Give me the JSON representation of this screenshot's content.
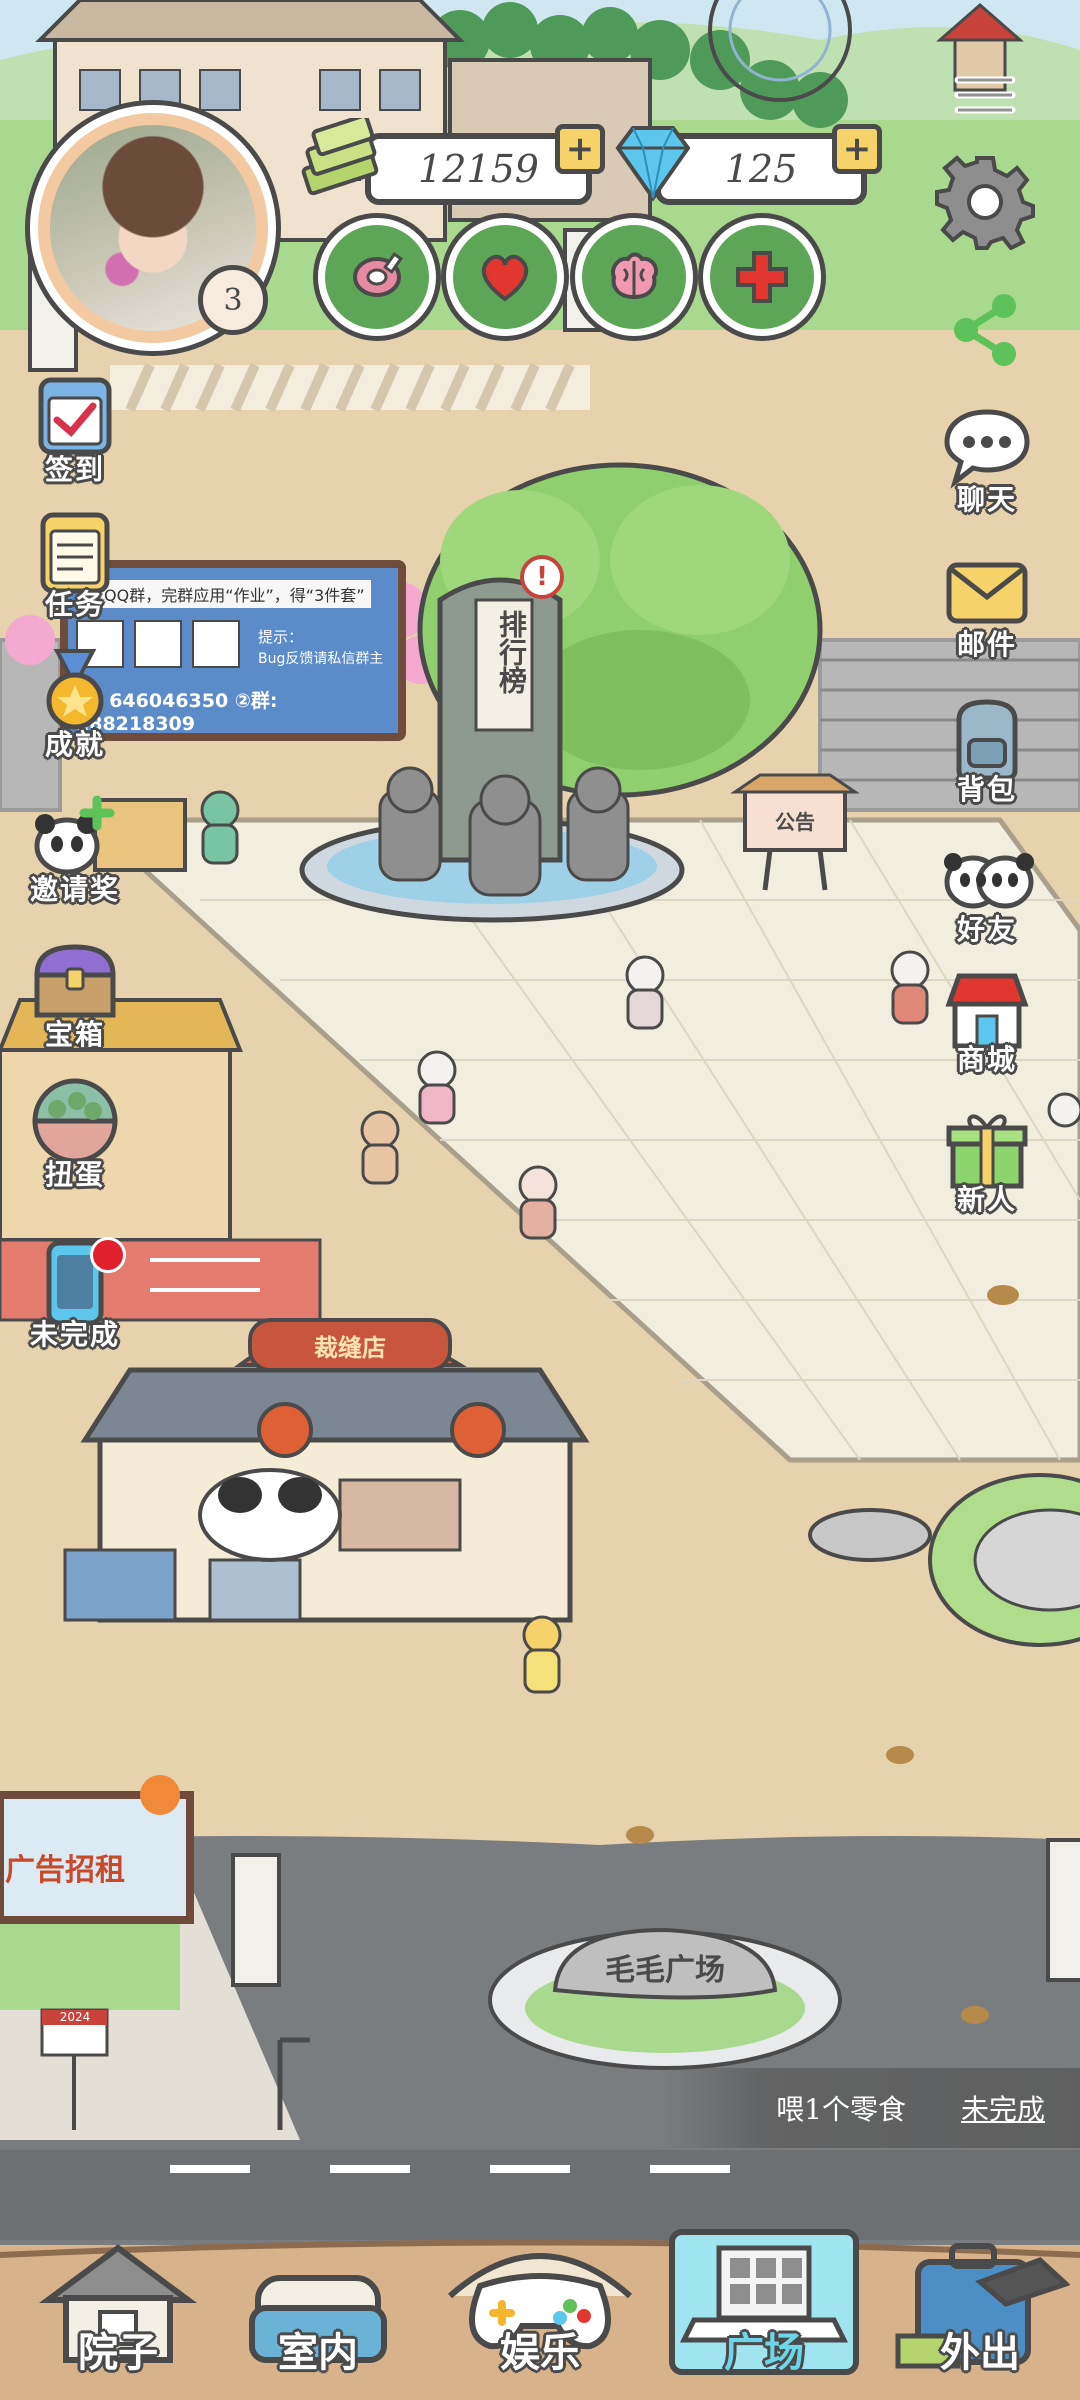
{
  "hud": {
    "level": "3",
    "coins": "12159",
    "diamonds": "125",
    "coin_plus": "+",
    "diamond_plus": "+"
  },
  "stats": [
    {
      "name": "food",
      "icon": "meat-icon"
    },
    {
      "name": "mood",
      "icon": "heart-icon"
    },
    {
      "name": "intelligence",
      "icon": "brain-icon"
    },
    {
      "name": "health",
      "icon": "medical-cross-icon"
    }
  ],
  "left_menu": [
    {
      "label": "签到",
      "icon": "calendar-check-icon"
    },
    {
      "label": "任务",
      "icon": "notepad-icon"
    },
    {
      "label": "成就",
      "icon": "medal-icon"
    },
    {
      "label": "邀请奖",
      "icon": "panda-gift-icon"
    },
    {
      "label": "宝箱",
      "icon": "treasure-chest-icon"
    },
    {
      "label": "扭蛋",
      "icon": "gashapon-icon"
    },
    {
      "label": "未完成",
      "icon": "phone-icon"
    }
  ],
  "right_menu": [
    {
      "label": "",
      "icon": "hamburger-menu-icon"
    },
    {
      "label": "",
      "icon": "gear-icon"
    },
    {
      "label": "",
      "icon": "share-icon"
    },
    {
      "label": "聊天",
      "icon": "chat-bubble-icon"
    },
    {
      "label": "邮件",
      "icon": "envelope-icon"
    },
    {
      "label": "背包",
      "icon": "backpack-icon"
    },
    {
      "label": "好友",
      "icon": "panda-friends-icon"
    },
    {
      "label": "商城",
      "icon": "shop-icon"
    },
    {
      "label": "新人",
      "icon": "gift-box-icon"
    }
  ],
  "board": {
    "line1": "QQ群，完群应用“作业”，得“3件套”",
    "hint_title": "提示：",
    "hint_body": "Bug反馈请私信群主",
    "group_line": "群: 646046350   ②群: 288218309"
  },
  "signs": {
    "ranking": "排行榜",
    "notice": "公告",
    "tailor_shop": "裁缝店",
    "plaza_stone": "毛毛广场",
    "ad_board": "广告招租",
    "year_sign": "2024"
  },
  "task_banner": {
    "text": "喂1个零食",
    "status": "未完成"
  },
  "bottom_nav": [
    {
      "label": "院子",
      "icon": "house-icon",
      "active": false
    },
    {
      "label": "室内",
      "icon": "sofa-icon",
      "active": false
    },
    {
      "label": "娱乐",
      "icon": "gamepad-icon",
      "active": false
    },
    {
      "label": "广场",
      "icon": "plaza-building-icon",
      "active": true
    },
    {
      "label": "外出",
      "icon": "suitcase-icon",
      "active": false
    }
  ],
  "colors": {
    "outline": "#4a4a4a",
    "stat_green": "#5ea657",
    "ground_sand": "#e6d3ad",
    "plaza_tile": "#f1eee0",
    "road_gray": "#7a7d80",
    "active_nav": "#6ed6e8"
  }
}
